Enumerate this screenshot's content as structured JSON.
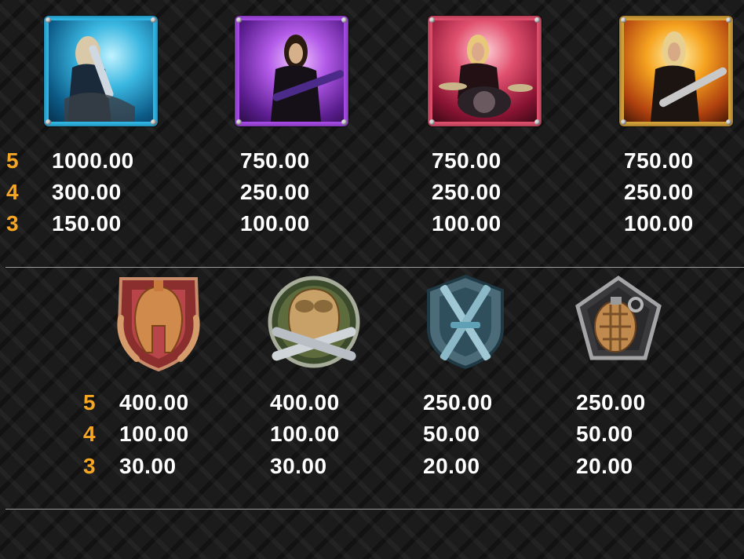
{
  "accent_color": "#f5a623",
  "premium": {
    "counts": [
      "5",
      "4",
      "3"
    ],
    "symbols": [
      {
        "name": "rocker-cyan",
        "frame_color": "#2fb8e8",
        "payouts": [
          "1000.00",
          "300.00",
          "150.00"
        ]
      },
      {
        "name": "rocker-purple",
        "frame_color": "#a64be6",
        "payouts": [
          "750.00",
          "250.00",
          "100.00"
        ]
      },
      {
        "name": "drummer-red",
        "frame_color": "#e0506e",
        "payouts": [
          "750.00",
          "250.00",
          "100.00"
        ]
      },
      {
        "name": "rocker-gold",
        "frame_color": "#d7a43a",
        "payouts": [
          "750.00",
          "250.00",
          "100.00"
        ]
      }
    ]
  },
  "low": {
    "counts": [
      "5",
      "4",
      "3"
    ],
    "symbols": [
      {
        "name": "spartan-helmet-icon",
        "payouts": [
          "400.00",
          "100.00",
          "30.00"
        ]
      },
      {
        "name": "pilot-helmet-icon",
        "payouts": [
          "400.00",
          "100.00",
          "30.00"
        ]
      },
      {
        "name": "crossed-swords-shield-icon",
        "payouts": [
          "250.00",
          "50.00",
          "20.00"
        ]
      },
      {
        "name": "grenade-icon",
        "payouts": [
          "250.00",
          "50.00",
          "20.00"
        ]
      }
    ]
  }
}
